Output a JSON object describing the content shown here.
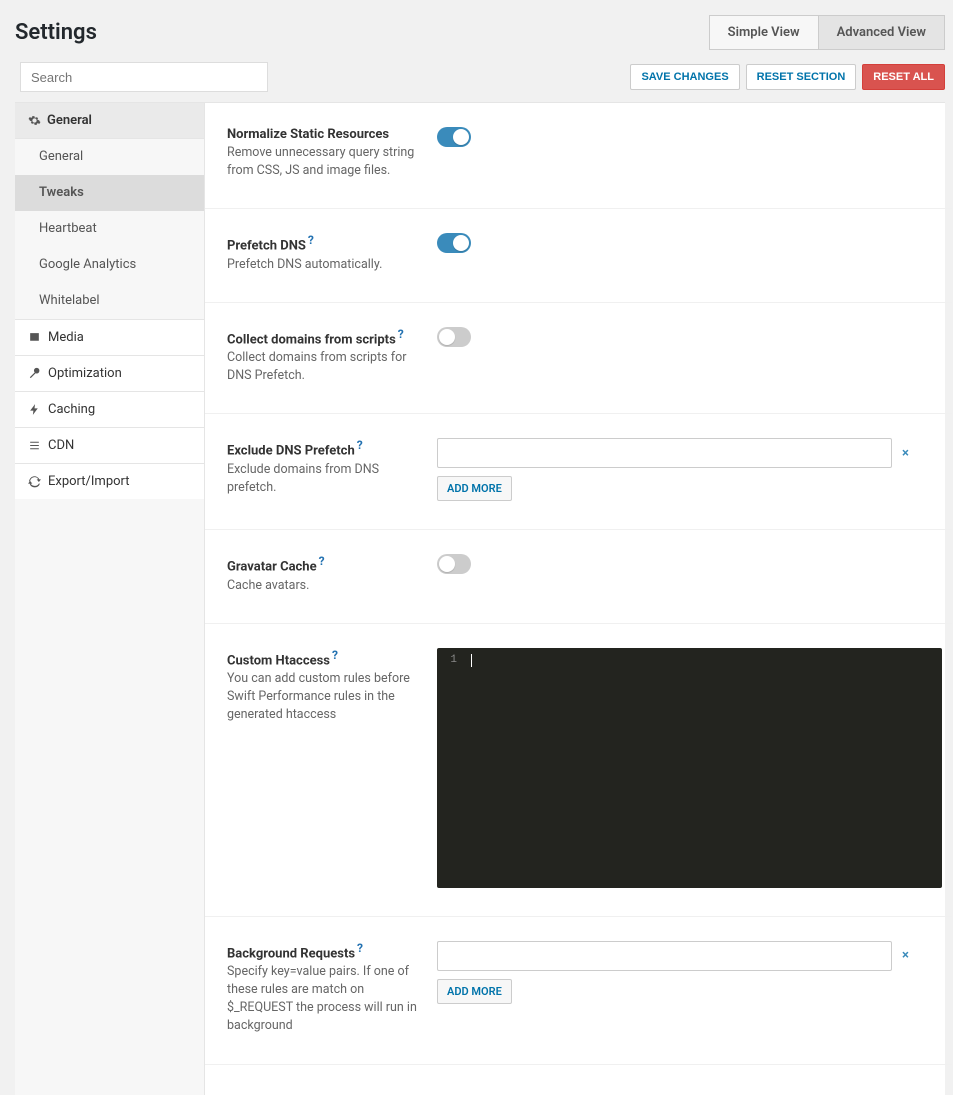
{
  "page_title": "Settings",
  "view_tabs": {
    "simple": "Simple View",
    "advanced": "Advanced View",
    "active": "advanced"
  },
  "search_placeholder": "Search",
  "actions": {
    "save": "SAVE CHANGES",
    "reset_section": "RESET SECTION",
    "reset_all": "RESET ALL"
  },
  "sidebar": {
    "general_group": "General",
    "general_subs": [
      {
        "label": "General",
        "active": false
      },
      {
        "label": "Tweaks",
        "active": true
      },
      {
        "label": "Heartbeat",
        "active": false
      },
      {
        "label": "Google Analytics",
        "active": false
      },
      {
        "label": "Whitelabel",
        "active": false
      }
    ],
    "items": [
      {
        "label": "Media",
        "icon": "image"
      },
      {
        "label": "Optimization",
        "icon": "wrench"
      },
      {
        "label": "Caching",
        "icon": "bolt"
      },
      {
        "label": "CDN",
        "icon": "list"
      },
      {
        "label": "Export/Import",
        "icon": "refresh"
      }
    ]
  },
  "settings": {
    "normalize": {
      "title": "Normalize Static Resources",
      "desc": "Remove unnecessary query string from CSS, JS and image files.",
      "value": true
    },
    "prefetch_dns": {
      "title": "Prefetch DNS",
      "desc": "Prefetch DNS automatically.",
      "help": true,
      "value": true
    },
    "collect_domains": {
      "title": "Collect domains from scripts",
      "desc": "Collect domains from scripts for DNS Prefetch.",
      "help": true,
      "value": false
    },
    "exclude_dns": {
      "title": "Exclude DNS Prefetch",
      "desc": "Exclude domains from DNS prefetch.",
      "help": true,
      "values": [
        ""
      ],
      "add_more": "ADD MORE"
    },
    "gravatar": {
      "title": "Gravatar Cache",
      "desc": "Cache avatars.",
      "help": true,
      "value": false
    },
    "htaccess": {
      "title": "Custom Htaccess",
      "desc": "You can add custom rules before Swift Performance rules in the generated htaccess",
      "help": true,
      "line_number": "1",
      "content": ""
    },
    "bg_requests": {
      "title": "Background Requests",
      "desc": "Specify key=value pairs. If one of these rules are match on $_REQUEST the process will run in background",
      "help": true,
      "values": [
        ""
      ],
      "add_more": "ADD MORE"
    }
  }
}
